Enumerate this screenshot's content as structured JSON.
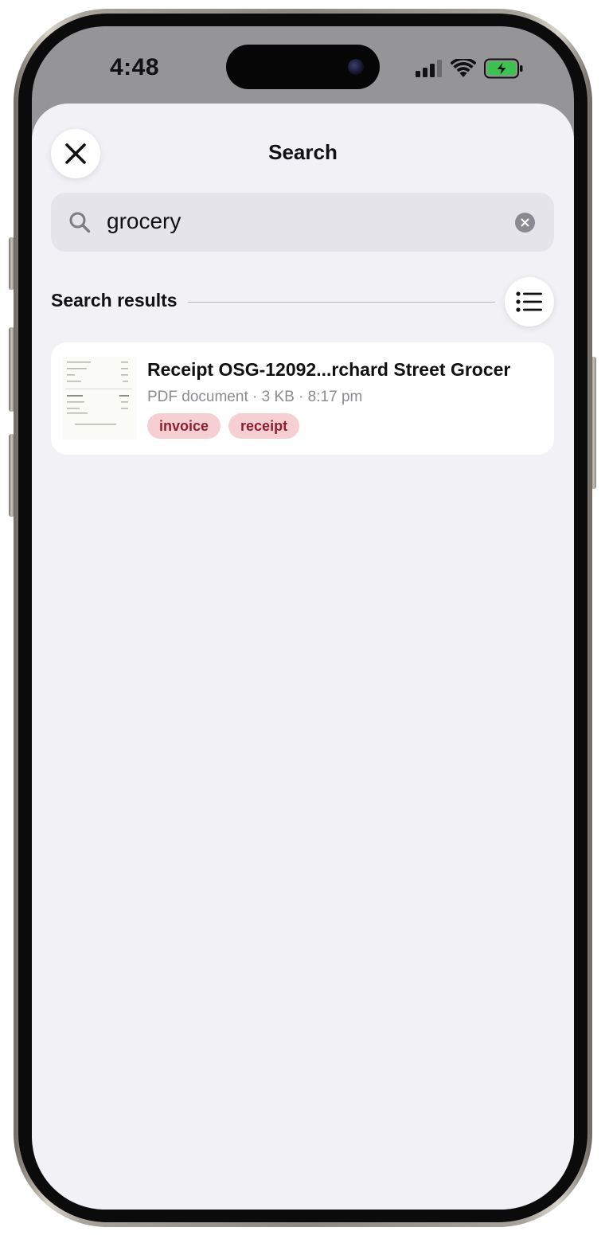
{
  "status_bar": {
    "time": "4:48",
    "icons": [
      "cellular-signal-icon",
      "wifi-icon",
      "battery-charging-icon"
    ]
  },
  "sheet": {
    "title": "Search",
    "close_icon": "close-icon"
  },
  "search": {
    "value": "grocery",
    "icon": "search-icon",
    "clear_icon": "clear-icon"
  },
  "results": {
    "label": "Search results",
    "view_toggle_icon": "list-view-icon",
    "items": [
      {
        "title": "Receipt OSG-12092...rchard Street Grocer",
        "meta": "PDF document · 3 KB · 8:17 pm",
        "tags": [
          "invoice",
          "receipt"
        ]
      }
    ]
  },
  "colors": {
    "sheet_background": "#f1f1f6",
    "tag_background": "#f6cfd3",
    "tag_text": "#8d2030",
    "battery_green": "#3cc251"
  }
}
